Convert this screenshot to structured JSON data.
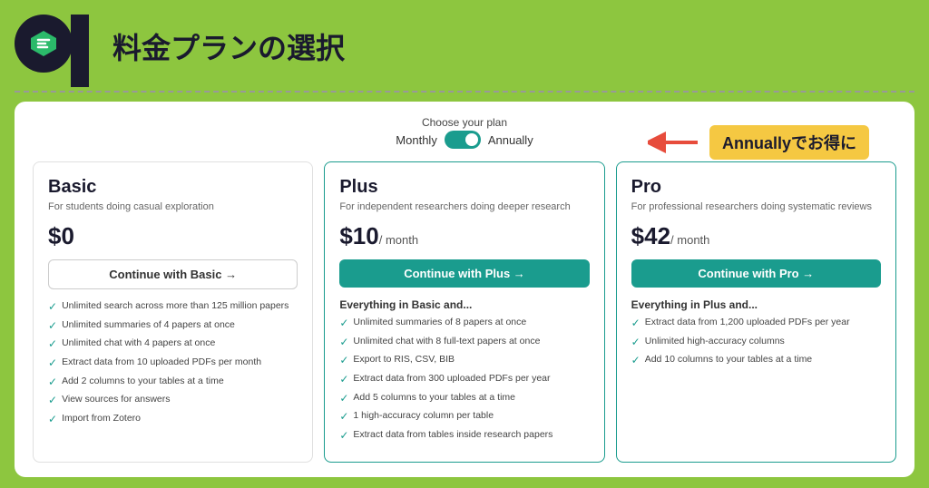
{
  "header": {
    "title": "料金プランの選択"
  },
  "toggle": {
    "label": "Choose your plan",
    "monthly": "Monthly",
    "annually": "Annually"
  },
  "annotation": {
    "text": "Annuallyでお得に"
  },
  "plans": [
    {
      "name": "Basic",
      "description": "For students doing casual exploration",
      "price": "$0",
      "price_sub": "",
      "button_label": "Continue with Basic →",
      "button_type": "outline",
      "features_header": "",
      "features": [
        "Unlimited search across more than 125 million papers",
        "Unlimited summaries of 4 papers at once",
        "Unlimited chat with 4 papers at once",
        "Extract data from 10 uploaded PDFs per month",
        "Add 2 columns to your tables at a time",
        "View sources for answers",
        "Import from Zotero"
      ]
    },
    {
      "name": "Plus",
      "description": "For independent researchers doing deeper research",
      "price": "$10",
      "price_sub": "/ month",
      "button_label": "Continue with Plus →",
      "button_type": "filled",
      "features_header": "Everything in Basic and...",
      "features": [
        "Unlimited summaries of 8 papers at once",
        "Unlimited chat with 8 full-text papers at once",
        "Export to RIS, CSV, BIB",
        "Extract data from 300 uploaded PDFs per year",
        "Add 5 columns to your tables at a time",
        "1 high-accuracy column per table",
        "Extract data from tables inside research papers"
      ]
    },
    {
      "name": "Pro",
      "description": "For professional researchers doing systematic reviews",
      "price": "$42",
      "price_sub": "/ month",
      "button_label": "Continue with Pro →",
      "button_type": "filled",
      "features_header": "Everything in Plus and...",
      "features": [
        "Extract data from 1,200 uploaded PDFs per year",
        "Unlimited high-accuracy columns",
        "Add 10 columns to your tables at a time"
      ]
    }
  ]
}
